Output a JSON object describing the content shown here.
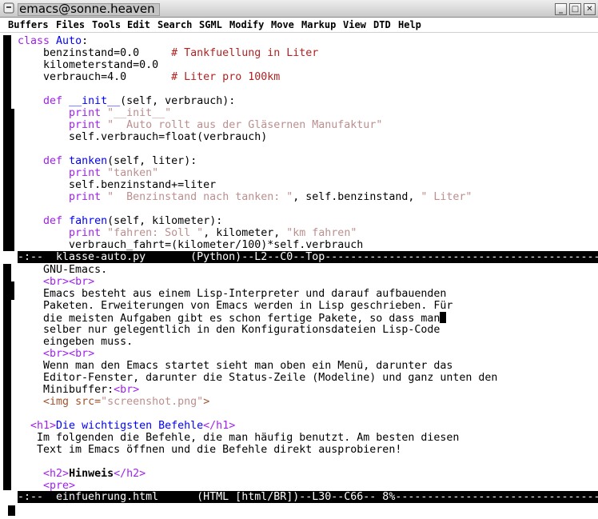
{
  "window": {
    "title": "emacs@sonne.heaven",
    "title_icon": "emacs-window-icon",
    "buttons": [
      "minimize-button",
      "maximize-button",
      "close-button"
    ]
  },
  "menu": {
    "items": [
      "Buffers",
      "Files",
      "Tools",
      "Edit",
      "Search",
      "SGML",
      "Modify",
      "Move",
      "Markup",
      "View",
      "DTD",
      "Help"
    ]
  },
  "top_buffer": {
    "lines": [
      [
        {
          "t": "class",
          "c": "kw"
        },
        {
          "t": " "
        },
        {
          "t": "Auto",
          "c": "fn"
        },
        {
          "t": ":"
        }
      ],
      [
        {
          "t": "    benzinstand=0.0     "
        },
        {
          "t": "# Tankfuellung in Liter",
          "c": "cm"
        }
      ],
      [
        {
          "t": "    kilometerstand=0.0"
        }
      ],
      [
        {
          "t": "    verbrauch=4.0       "
        },
        {
          "t": "# Liter pro 100km",
          "c": "cm"
        }
      ],
      [
        {
          "t": ""
        }
      ],
      [
        {
          "t": "    "
        },
        {
          "t": "def",
          "c": "kw"
        },
        {
          "t": " "
        },
        {
          "t": "__init__",
          "c": "fn"
        },
        {
          "t": "(self, verbrauch):"
        }
      ],
      [
        {
          "t": "        "
        },
        {
          "t": "print",
          "c": "kw"
        },
        {
          "t": " "
        },
        {
          "t": "\"__init__\"",
          "c": "str"
        }
      ],
      [
        {
          "t": "        "
        },
        {
          "t": "print",
          "c": "kw"
        },
        {
          "t": " "
        },
        {
          "t": "\"  Auto rollt aus der Gläsernen Manufaktur\"",
          "c": "str"
        }
      ],
      [
        {
          "t": "        self.verbrauch=float(verbrauch)"
        }
      ],
      [
        {
          "t": ""
        }
      ],
      [
        {
          "t": "    "
        },
        {
          "t": "def",
          "c": "kw"
        },
        {
          "t": " "
        },
        {
          "t": "tanken",
          "c": "fn"
        },
        {
          "t": "(self, liter):"
        }
      ],
      [
        {
          "t": "        "
        },
        {
          "t": "print",
          "c": "kw"
        },
        {
          "t": " "
        },
        {
          "t": "\"tanken\"",
          "c": "str"
        }
      ],
      [
        {
          "t": "        self.benzinstand+=liter"
        }
      ],
      [
        {
          "t": "        "
        },
        {
          "t": "print",
          "c": "kw"
        },
        {
          "t": " "
        },
        {
          "t": "\"  Benzinstand nach tanken: \"",
          "c": "str"
        },
        {
          "t": ", self.benzinstand, "
        },
        {
          "t": "\" Liter\"",
          "c": "str"
        }
      ],
      [
        {
          "t": ""
        }
      ],
      [
        {
          "t": "    "
        },
        {
          "t": "def",
          "c": "kw"
        },
        {
          "t": " "
        },
        {
          "t": "fahren",
          "c": "fn"
        },
        {
          "t": "(self, kilometer):"
        }
      ],
      [
        {
          "t": "        "
        },
        {
          "t": "print",
          "c": "kw"
        },
        {
          "t": " "
        },
        {
          "t": "\"fahren: Soll \"",
          "c": "str"
        },
        {
          "t": ", kilometer, "
        },
        {
          "t": "\"km fahren\"",
          "c": "str"
        }
      ],
      [
        {
          "t": "        verbrauch_fahrt=(kilometer/100)*self.verbrauch"
        }
      ]
    ],
    "modeline": "-:--  klasse-auto.py       (Python)--L2--C0--Top------------------------------------------------------------"
  },
  "bottom_buffer": {
    "lines": [
      [
        {
          "t": "    GNU-Emacs."
        }
      ],
      [
        {
          "t": "    "
        },
        {
          "t": "<br>",
          "c": "tagc"
        },
        {
          "t": "<br>",
          "c": "tagc"
        }
      ],
      [
        {
          "t": "    Emacs besteht aus einem Lisp-Interpreter und darauf aufbauenden"
        }
      ],
      [
        {
          "t": "    Paketen. Erweiterungen von Emacs werden in Lisp geschrieben. Für"
        }
      ],
      [
        {
          "t": "    die meisten Aufgaben gibt es schon fertige Pakete, so dass man"
        },
        {
          "t": " ",
          "c": "cursor"
        }
      ],
      [
        {
          "t": "    selber nur gelegentlich in den Konfigurationsdateien Lisp-Code"
        }
      ],
      [
        {
          "t": "    eingeben muss."
        }
      ],
      [
        {
          "t": "    "
        },
        {
          "t": "<br>",
          "c": "tagc"
        },
        {
          "t": "<br>",
          "c": "tagc"
        }
      ],
      [
        {
          "t": "    Wenn man den Emacs startet sieht man oben ein Menü, darunter das"
        }
      ],
      [
        {
          "t": "    Editor-Fenster, darunter die Status-Zeile (Modeline) und ganz unten den"
        }
      ],
      [
        {
          "t": "    Minibuffer:"
        },
        {
          "t": "<br>",
          "c": "tagc"
        }
      ],
      [
        {
          "t": "    "
        },
        {
          "t": "<img ",
          "c": "attr"
        },
        {
          "t": "src=",
          "c": "attr"
        },
        {
          "t": "\"screenshot.png\"",
          "c": "str"
        },
        {
          "t": ">",
          "c": "attr"
        }
      ],
      [
        {
          "t": ""
        }
      ],
      [
        {
          "t": "  "
        },
        {
          "t": "<h1>",
          "c": "tagc"
        },
        {
          "t": "Die wichtigsten Befehle",
          "c": "tagn"
        },
        {
          "t": "</h1>",
          "c": "tagc"
        }
      ],
      [
        {
          "t": "   Im folgenden die Befehle, die man häufig benutzt. Am besten diesen"
        }
      ],
      [
        {
          "t": "   Text im Emacs öffnen und die Befehle direkt ausprobieren!"
        }
      ],
      [
        {
          "t": ""
        }
      ],
      [
        {
          "t": "    "
        },
        {
          "t": "<h2>",
          "c": "tagc"
        },
        {
          "t": "Hinweis",
          "c": "bold"
        },
        {
          "t": "</h2>",
          "c": "tagc"
        }
      ],
      [
        {
          "t": "    "
        },
        {
          "t": "<pre>",
          "c": "tagc"
        }
      ]
    ],
    "modeline": "-:--  einfuehrung.html      (HTML [html/BR])--L30--C66-- 8%---------------------------------------------"
  },
  "colors": {
    "keyword": "#a020f0",
    "function": "#0000ff",
    "string": "#bc8f8f",
    "comment": "#b22222",
    "modeline_bg": "#000000",
    "modeline_fg": "#ffffff"
  }
}
